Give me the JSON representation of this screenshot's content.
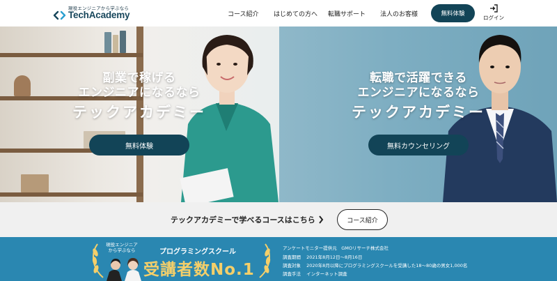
{
  "header": {
    "logo_tagline": "現役エンジニアから学ぶなら",
    "logo_text": "TechAcademy",
    "nav": {
      "courses": "コース紹介",
      "beginners": "はじめての方へ",
      "career": "転職サポート",
      "corporate": "法人のお客様"
    },
    "cta_label": "無料体験",
    "login_label": "ログイン"
  },
  "hero_left": {
    "line1": "副業で稼げる",
    "line2": "エンジニアになるなら",
    "brand": "テックアカデミー",
    "button_label": "無料体験"
  },
  "hero_right": {
    "line1": "転職で活躍できる",
    "line2": "エンジニアになるなら",
    "brand": "テックアカデミー",
    "button_label": "無料カウンセリング"
  },
  "course_strip": {
    "text": "テックアカデミーで学べるコースはこちら",
    "button_label": "コース紹介"
  },
  "banner": {
    "badge_small": "現役エンジニア\nから学ぶなら",
    "program_label": "プログラミングスクール",
    "headline": "受講者数No.1",
    "survey": [
      {
        "label": "",
        "value": "アンケートモニター提供元　GMOリサーチ株式会社"
      },
      {
        "label": "調査期間",
        "value": "2021年8月12日〜8月16日"
      },
      {
        "label": "調査対象",
        "value": "2020年8月以降にプログラミングスクールを受講した18〜80歳の男女1,000名"
      },
      {
        "label": "調査手法",
        "value": "インターネット調査"
      }
    ]
  },
  "colors": {
    "brand_dark": "#124457",
    "banner_blue": "#2a87b1",
    "gold": "#f4cf6a"
  }
}
